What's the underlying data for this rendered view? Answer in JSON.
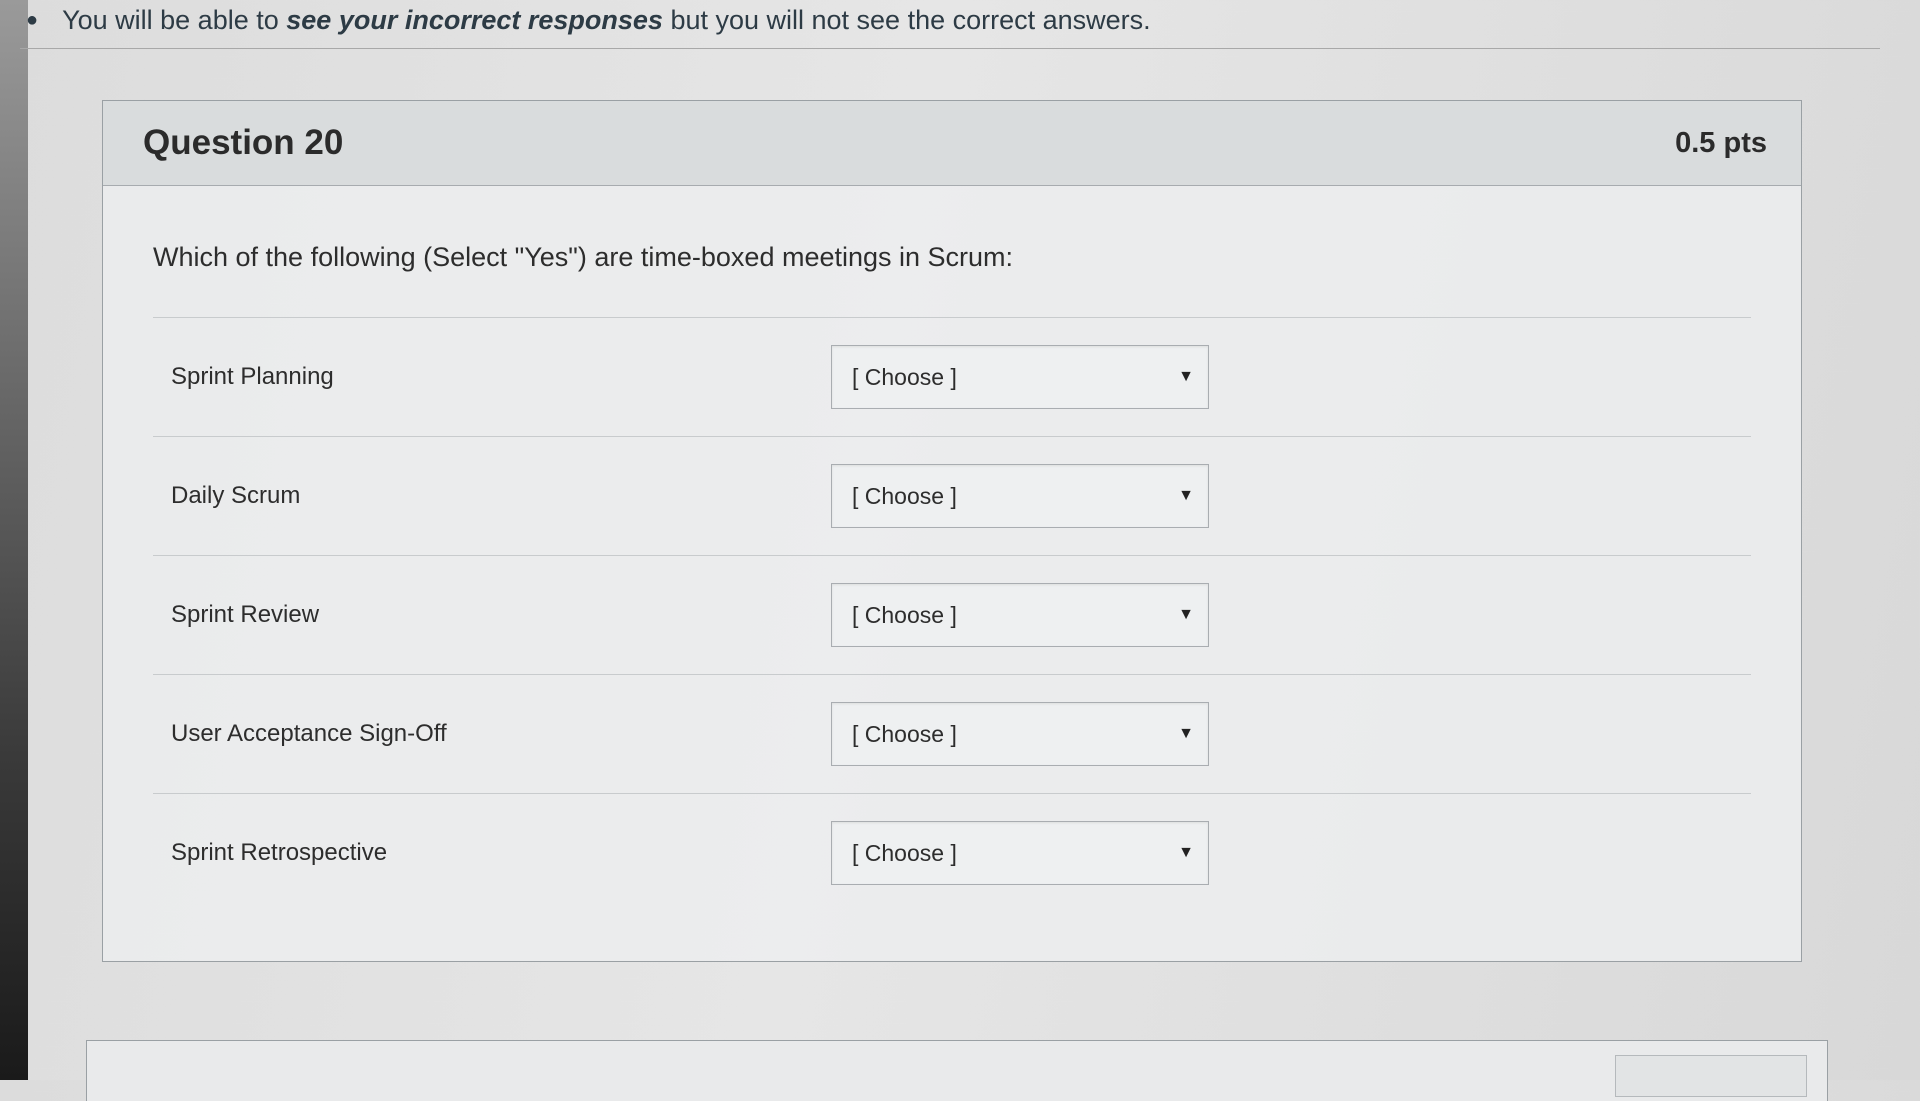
{
  "notice": {
    "prefix": "You will be able to ",
    "emphasis": "see your incorrect responses",
    "suffix": " but you will not see the correct answers."
  },
  "question": {
    "title": "Question 20",
    "points": "0.5 pts",
    "text": "Which of the following (Select \"Yes\") are time-boxed meetings in Scrum:",
    "rows": [
      {
        "label": "Sprint Planning",
        "selected": "[ Choose ]"
      },
      {
        "label": "Daily Scrum",
        "selected": "[ Choose ]"
      },
      {
        "label": "Sprint Review",
        "selected": "[ Choose ]"
      },
      {
        "label": "User Acceptance Sign-Off",
        "selected": "[ Choose ]"
      },
      {
        "label": "Sprint Retrospective",
        "selected": "[ Choose ]"
      }
    ]
  },
  "icons": {
    "dropdown": "caret-down-icon"
  }
}
